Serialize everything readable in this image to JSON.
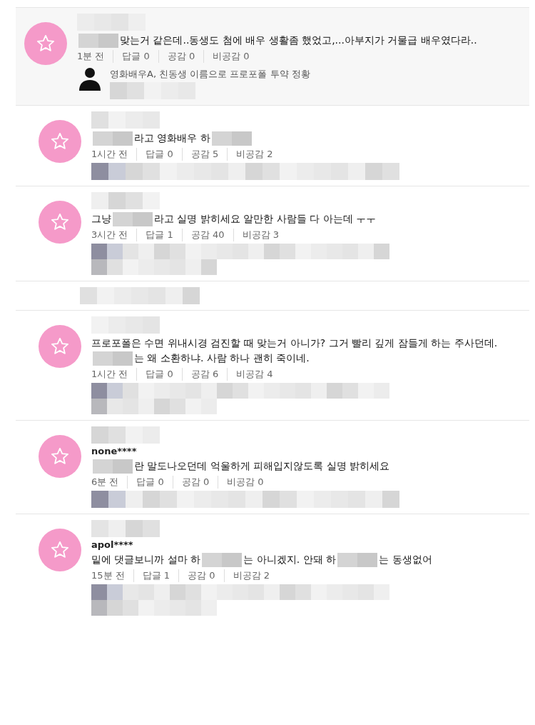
{
  "comments": [
    {
      "kind": "comment",
      "highlighted": true,
      "body": [
        {
          "kind": "mosaic"
        },
        {
          "kind": "text",
          "text": "맞는거 같은데..동생도 첨에 배우 생활좀 했었고,...아부지가 거물급 배우였다라.."
        }
      ],
      "time": "1분 전",
      "replies": "답글 0",
      "likes": "공감 0",
      "dislikes": "비공감 0",
      "attachment": {
        "kind": "link",
        "title": "영화배우A, 친동생 이름으로 프로포폴 투약 정황"
      }
    },
    {
      "kind": "comment",
      "highlighted": false,
      "body": [
        {
          "kind": "mosaic"
        },
        {
          "kind": "text",
          "text": "라고 영화배우 하"
        },
        {
          "kind": "mosaic"
        }
      ],
      "time": "1시간 전",
      "replies": "답글 0",
      "likes": "공감 5",
      "dislikes": "비공감 2",
      "attachment": {
        "kind": "short_mosaic"
      }
    },
    {
      "kind": "comment",
      "highlighted": false,
      "body": [
        {
          "kind": "text",
          "text": "그냥"
        },
        {
          "kind": "mosaic"
        },
        {
          "kind": "text",
          "text": "라고 실명 밝히세요 알만한 사람들 다 아는데 ㅜㅜ"
        }
      ],
      "time": "3시간 전",
      "replies": "답글 1",
      "likes": "공감 40",
      "dislikes": "비공감 3",
      "attachment": {
        "kind": "tall_mosaic"
      }
    },
    {
      "kind": "hidden"
    },
    {
      "kind": "comment",
      "highlighted": false,
      "body": [
        {
          "kind": "text",
          "text": "프로포폴은 수면 위내시경 검진할 때 맞는거 아니가? 그거 빨리 깊게 잠들게 하는 주사던데."
        },
        {
          "kind": "break"
        },
        {
          "kind": "mosaic"
        },
        {
          "kind": "text",
          "text": "는 왜 소환하냐. 사람 하나 괜히 죽이네."
        }
      ],
      "time": "1시간 전",
      "replies": "답글 0",
      "likes": "공감 6",
      "dislikes": "비공감 4",
      "attachment": {
        "kind": "tall_mosaic"
      }
    },
    {
      "kind": "comment",
      "highlighted": false,
      "user": "none****",
      "body": [
        {
          "kind": "mosaic"
        },
        {
          "kind": "text",
          "text": "란 말도나오던데 억울하게 피해입지않도록 실명 밝히세요"
        }
      ],
      "time": "6분 전",
      "replies": "답글 0",
      "likes": "공감 0",
      "dislikes": "비공감 0",
      "attachment": {
        "kind": "short_mosaic"
      }
    },
    {
      "kind": "comment",
      "highlighted": false,
      "user": "apol****",
      "body": [
        {
          "kind": "text",
          "text": "밑에 댓글보니까 설마 하"
        },
        {
          "kind": "mosaic"
        },
        {
          "kind": "text",
          "text": "는 아니겠지. 안돼 하"
        },
        {
          "kind": "mosaic"
        },
        {
          "kind": "text",
          "text": "는 동생없어"
        }
      ],
      "time": "15분 전",
      "replies": "답글 1",
      "likes": "공감 0",
      "dislikes": "비공감 2",
      "attachment": {
        "kind": "tall_mosaic"
      }
    }
  ]
}
